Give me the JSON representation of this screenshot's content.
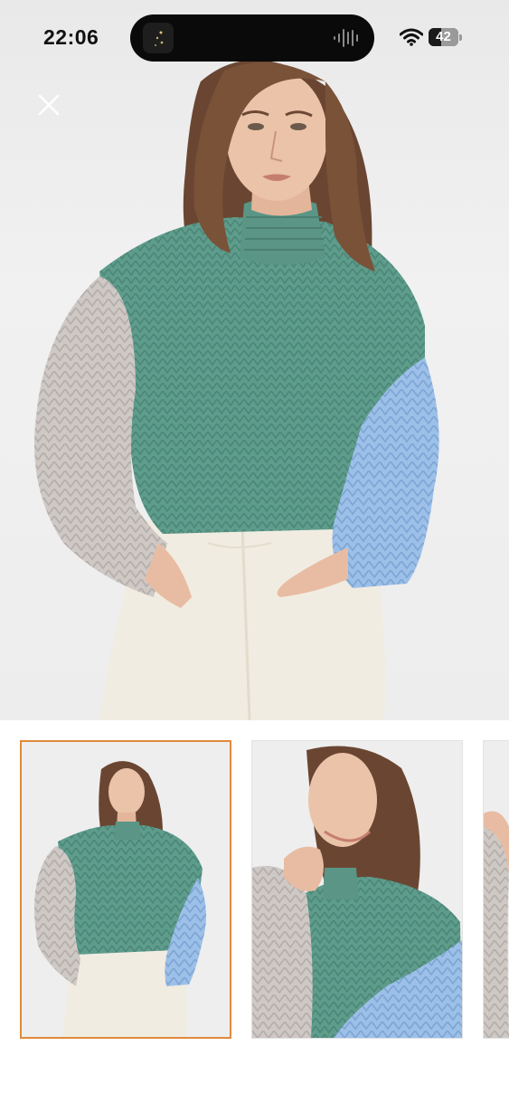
{
  "status_bar": {
    "time": "22:06",
    "battery_percent": "42",
    "battery_level": 0.42,
    "icons": [
      "wifi-icon",
      "battery-icon",
      "audio-waveform-icon"
    ]
  },
  "gallery": {
    "close_icon": "close-icon",
    "selected_index": 0,
    "thumbnails": [
      {
        "view": "front"
      },
      {
        "view": "side"
      },
      {
        "view": "partial"
      }
    ]
  },
  "colors": {
    "background": "#ffffff",
    "selection_border": "#e08a3c",
    "sweater_green": "#5e9c8c",
    "sleeve_grey": "#cfc9c6",
    "sleeve_blue": "#9dc0e8",
    "pants_cream": "#f1ece1"
  }
}
